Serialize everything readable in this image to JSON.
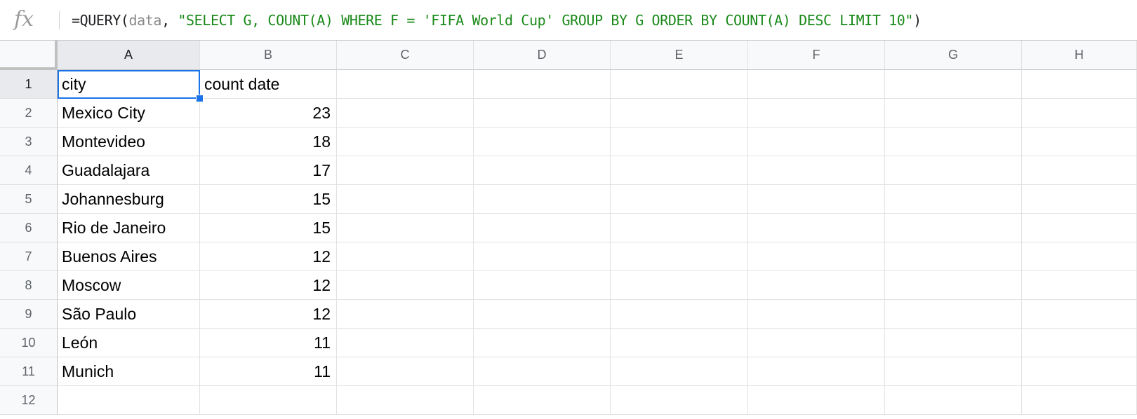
{
  "formula_bar": {
    "fx_label": "fx",
    "formula_prefix": "=QUERY(",
    "formula_range": "data",
    "formula_comma": ", ",
    "formula_query": "\"SELECT G, COUNT(A) WHERE F = 'FIFA World Cup' GROUP BY G ORDER BY COUNT(A) DESC LIMIT 10\"",
    "formula_suffix": ")"
  },
  "columns": [
    "A",
    "B",
    "C",
    "D",
    "E",
    "F",
    "G",
    "H"
  ],
  "rows": [
    {
      "num": "1",
      "a": "city",
      "b": "count date"
    },
    {
      "num": "2",
      "a": "Mexico City",
      "b": "23"
    },
    {
      "num": "3",
      "a": "Montevideo",
      "b": "18"
    },
    {
      "num": "4",
      "a": "Guadalajara",
      "b": "17"
    },
    {
      "num": "5",
      "a": "Johannesburg",
      "b": "15"
    },
    {
      "num": "6",
      "a": "Rio de Janeiro",
      "b": "15"
    },
    {
      "num": "7",
      "a": "Buenos Aires",
      "b": "12"
    },
    {
      "num": "8",
      "a": "Moscow",
      "b": "12"
    },
    {
      "num": "9",
      "a": "São Paulo",
      "b": "12"
    },
    {
      "num": "10",
      "a": "León",
      "b": "11"
    },
    {
      "num": "11",
      "a": "Munich",
      "b": "11"
    },
    {
      "num": "12",
      "a": "",
      "b": ""
    }
  ],
  "selection": {
    "cell": "A1",
    "color": "#1a73e8"
  }
}
